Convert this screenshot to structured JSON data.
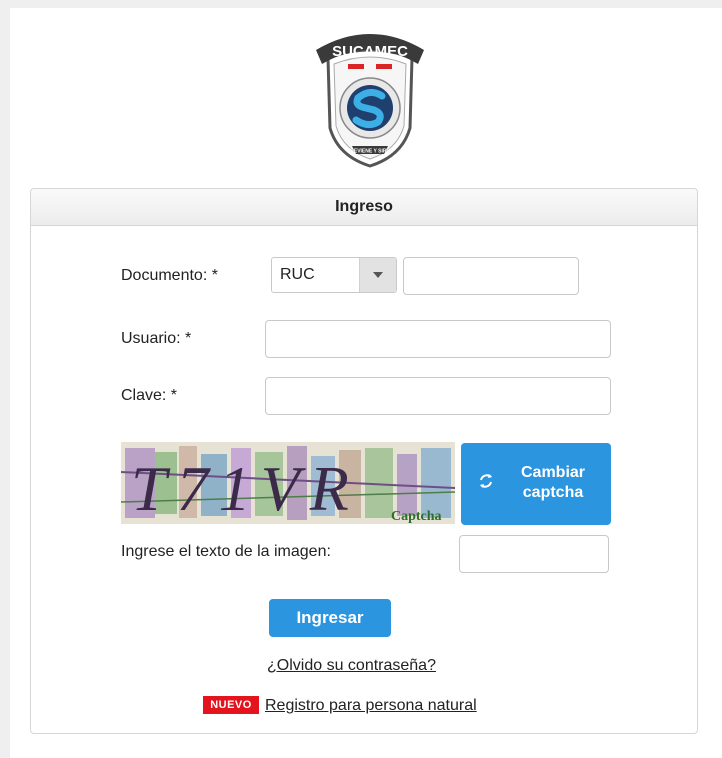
{
  "brand": {
    "logo_text": "SUCAMEC",
    "logo_motto": "PREVIENE Y SIRVE"
  },
  "panel": {
    "title": "Ingreso"
  },
  "form": {
    "documento_label": "Documento: *",
    "documento_type_selected": "RUC",
    "documento_value": "",
    "usuario_label": "Usuario: *",
    "usuario_value": "",
    "clave_label": "Clave: *",
    "clave_value": "",
    "captcha_text": "T71VR",
    "captcha_watermark": "Captcha",
    "change_captcha_label_1": "Cambiar",
    "change_captcha_label_2": "captcha",
    "captcha_input_label": "Ingrese el texto de la imagen:",
    "captcha_input_value": "",
    "submit_label": "Ingresar"
  },
  "links": {
    "forgot_password": "¿Olvido su contraseña?",
    "new_badge": "NUEVO",
    "register": "Registro para persona natural"
  },
  "colors": {
    "accent": "#2b95e0",
    "badge": "#e3141e"
  }
}
